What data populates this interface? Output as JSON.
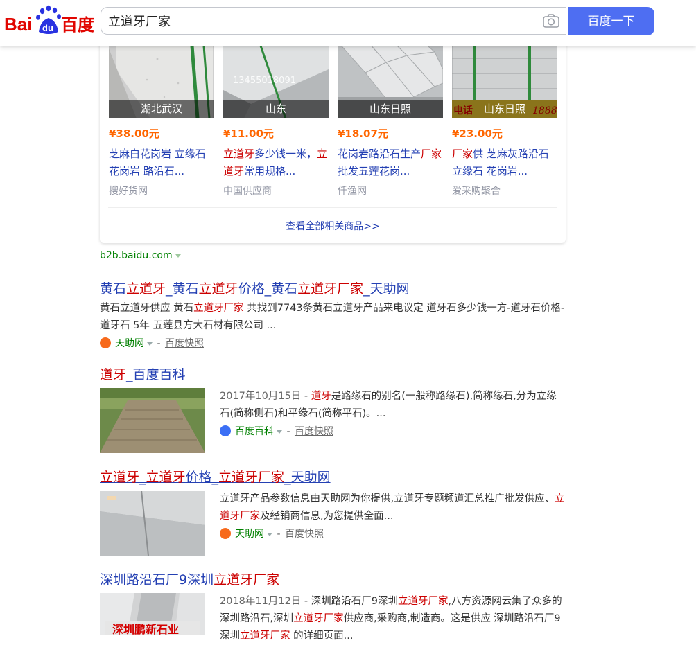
{
  "header": {
    "query": "立道牙厂家",
    "search_button": "百度一下",
    "logo_text": "Bai du 百度"
  },
  "products": [
    {
      "caption": "湖北武汉",
      "price": "¥38.00元",
      "title": "芝麻白花岗岩 立缘石 花岗岩 路沿石...",
      "source": "搜好货网"
    },
    {
      "caption": "山东",
      "price": "¥11.00元",
      "title_parts": [
        "立道牙",
        "多少钱一米，",
        "立道牙",
        "常用规格..."
      ],
      "source": "中国供应商",
      "watermark": "13455018091"
    },
    {
      "caption": "山东日照",
      "price": "¥18.07元",
      "title_parts": [
        "花岗岩路沿石生产",
        "厂家",
        "批发五莲花岗..."
      ],
      "source": "仟渔网"
    },
    {
      "caption": "山东日照",
      "price": "¥23.00元",
      "title_parts": [
        "厂家",
        "供 芝麻灰路沿石 立缘石 花岗岩..."
      ],
      "source": "爱采购聚合",
      "watermark_left": "电话",
      "watermark_right": "1888"
    }
  ],
  "view_all": "查看全部相关商品>>",
  "site_label": "b2b.baidu.com",
  "results": [
    {
      "title_parts": [
        "黄石",
        "立道牙",
        "_黄石",
        "立道牙",
        "价格_黄石",
        "立道牙厂家",
        "_天助网"
      ],
      "desc_parts": [
        "黄石立道牙供应 黄石",
        "立道牙厂家",
        " 共找到7743条黄石立道牙产品来电议定 道牙石多少钱一方-道牙石价格-道牙石 5年 五莲县方大石材有限公司 ..."
      ],
      "source": "天助网",
      "cache": "百度快照"
    },
    {
      "title_parts": [
        "道牙",
        "_百度百科"
      ],
      "date": "2017年10月15日 - ",
      "desc_parts": [
        "道牙",
        "是路缘石的别名(一般称路缘石),简称缘石,分为立缘石(简称侧石)和平缘石(简称平石)。..."
      ],
      "source": "百度百科",
      "cache": "百度快照"
    },
    {
      "title_parts": [
        "立道牙",
        "_",
        "立道牙",
        "价格_",
        "立道牙厂家",
        "_天助网"
      ],
      "desc_parts": [
        "立道牙产品参数信息由天助网为你提供,立道牙专题频道汇总推广批发供应、",
        "立道牙厂家",
        "及经销商信息,为您提供全面..."
      ],
      "source": "天助网",
      "cache": "百度快照"
    },
    {
      "title_parts": [
        "深圳路沿石厂9深圳",
        "立道牙厂家"
      ],
      "date": "2018年11月12日 - ",
      "desc_parts": [
        "深圳路沿石厂9深圳",
        "立道牙厂家",
        ",八方资源网云集了众多的深圳路沿石,深圳",
        "立道牙厂家",
        "供应商,采购商,制造商。这是供应 深圳路沿石厂9深圳",
        "立道牙厂家",
        " 的详细页面..."
      ],
      "thumb_text": "深圳鹏新石业"
    }
  ],
  "colors": {
    "brand_blue": "#4e6ef2",
    "link": "#2440b3",
    "highlight": "#cc0000",
    "price": "#ff6600",
    "url_green": "#008000"
  }
}
